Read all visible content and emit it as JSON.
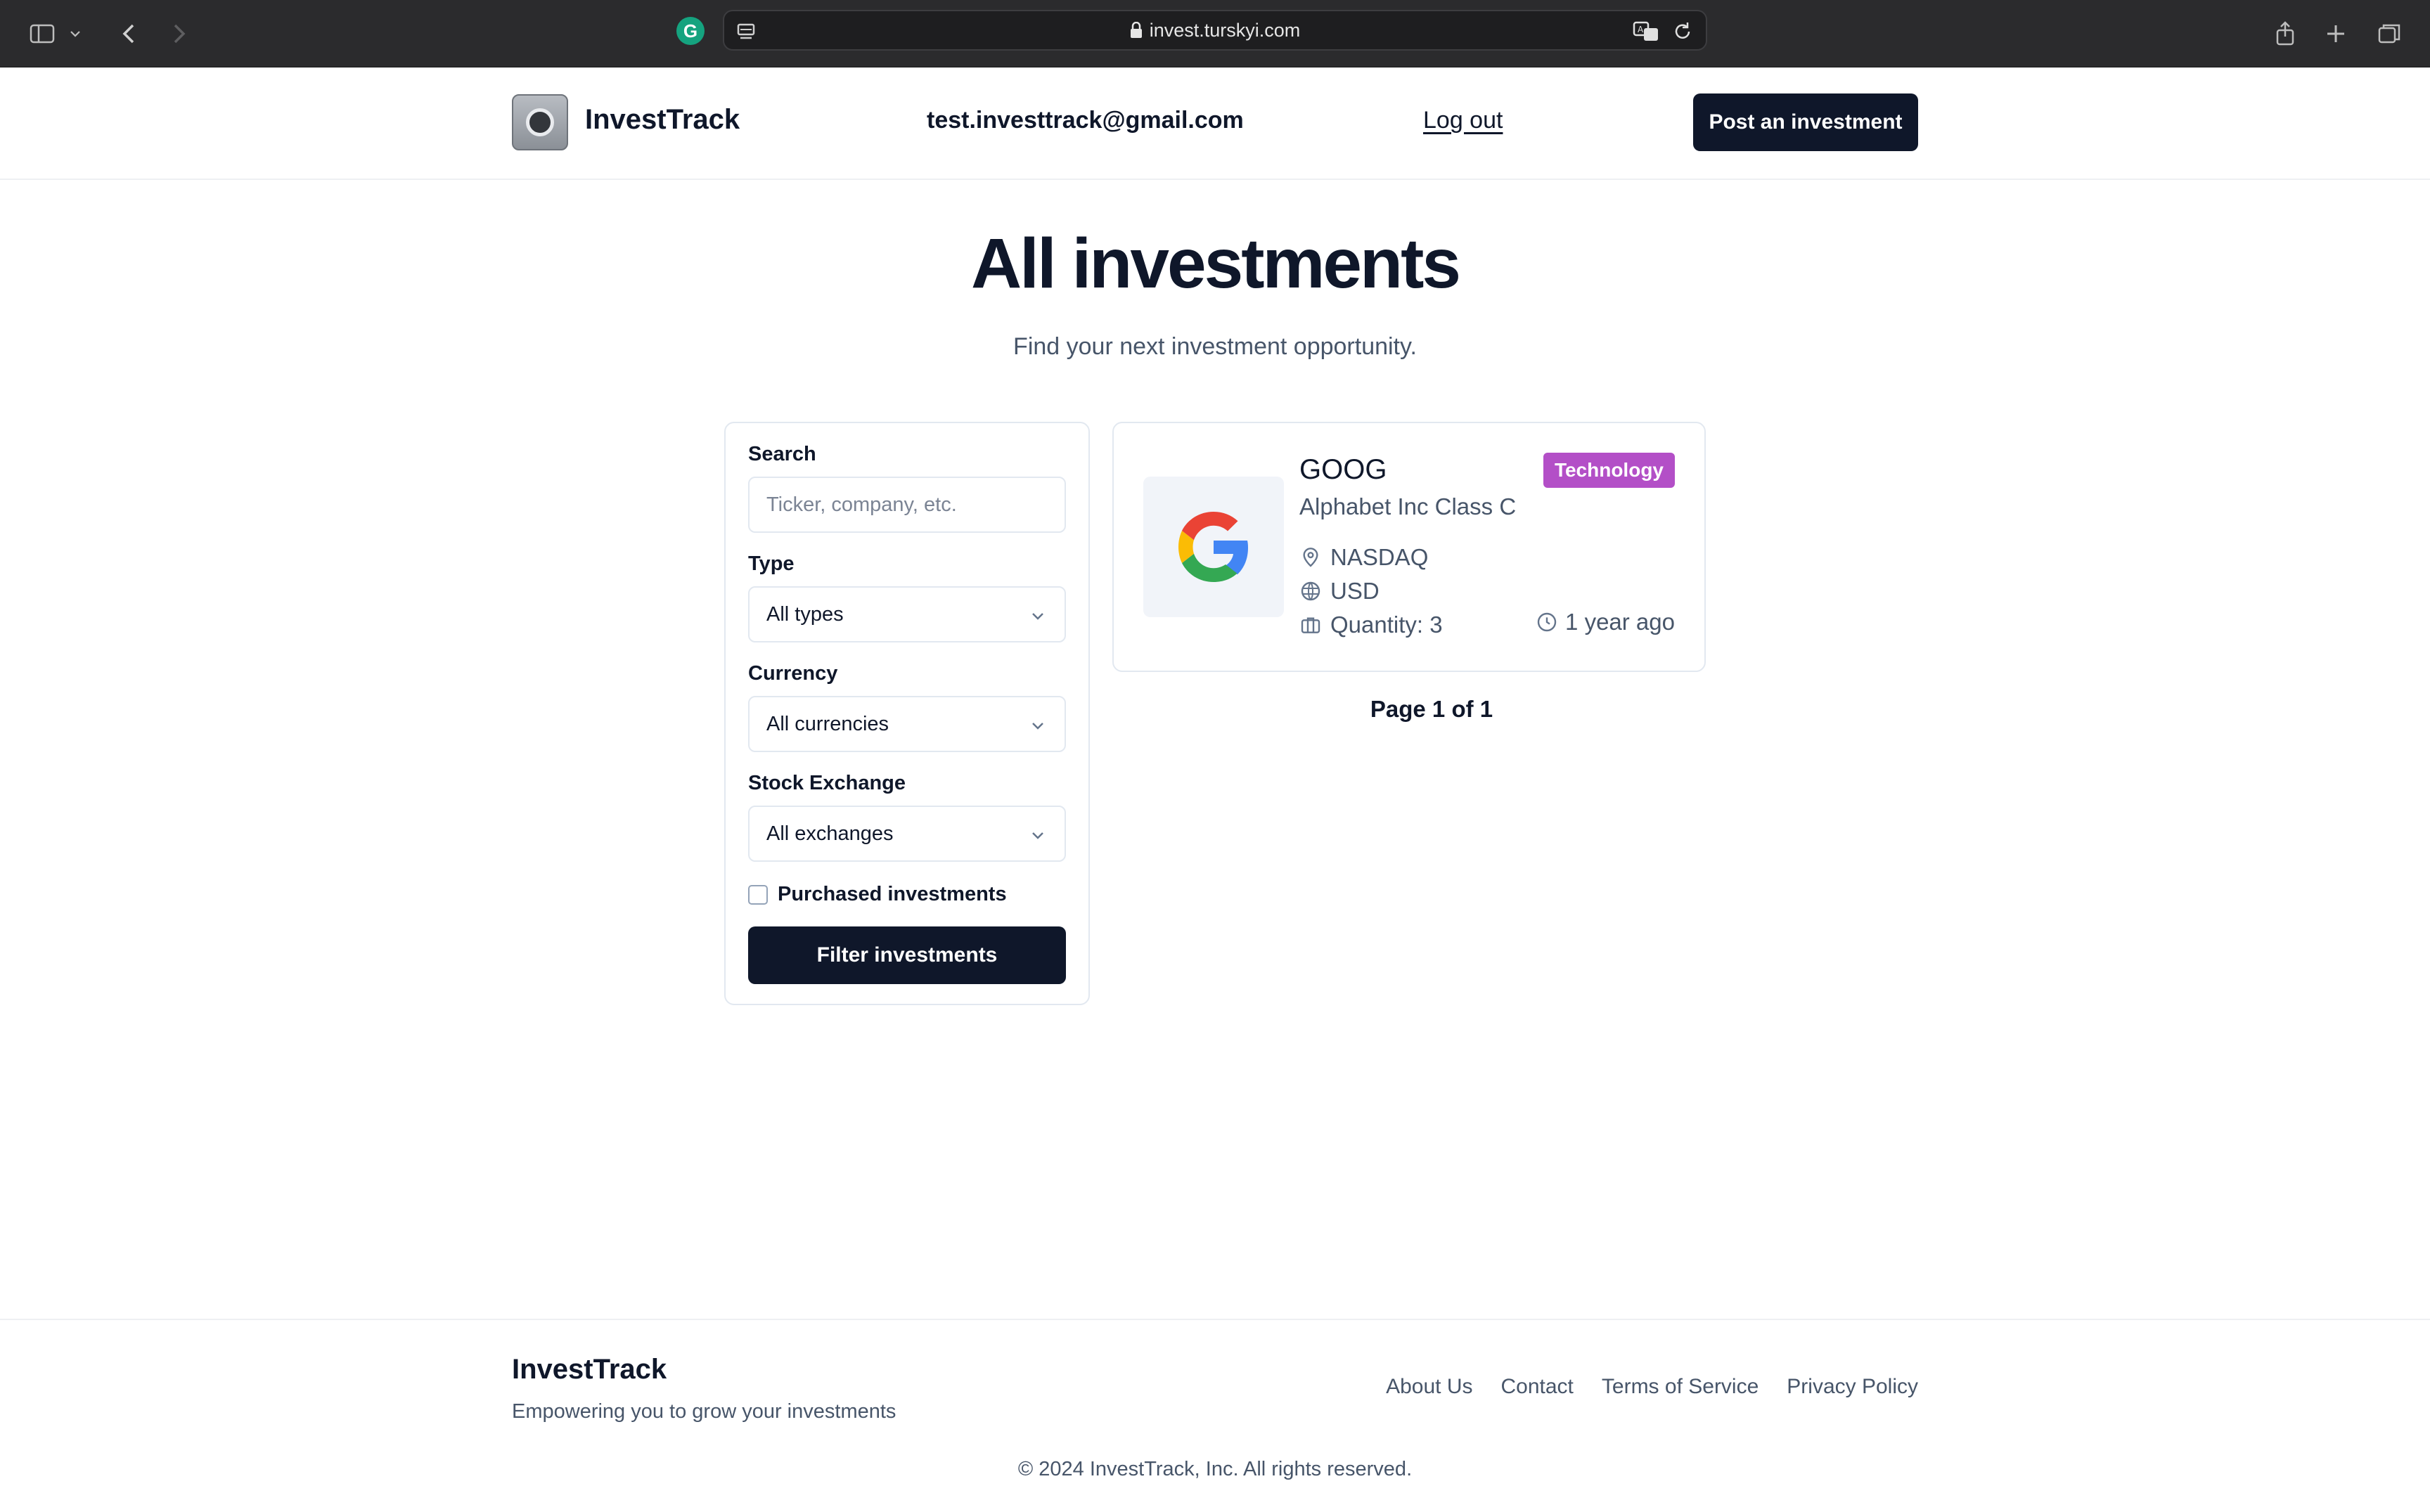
{
  "browser": {
    "url": "invest.turskyi.com",
    "grammarly_letter": "G"
  },
  "header": {
    "brand": "InvestTrack",
    "user_email": "test.investtrack@gmail.com",
    "logout_label": "Log out",
    "post_button_label": "Post an investment"
  },
  "hero": {
    "title": "All investments",
    "subtitle": "Find your next investment opportunity."
  },
  "filters": {
    "search_label": "Search",
    "search_placeholder": "Ticker, company, etc.",
    "type_label": "Type",
    "type_value": "All types",
    "currency_label": "Currency",
    "currency_value": "All currencies",
    "exchange_label": "Stock Exchange",
    "exchange_value": "All exchanges",
    "purchased_label": "Purchased investments",
    "purchased_checked": false,
    "submit_label": "Filter investments"
  },
  "investments": [
    {
      "ticker": "GOOG",
      "company": "Alphabet Inc Class C",
      "category": "Technology",
      "exchange": "NASDAQ",
      "currency": "USD",
      "quantity_text": "Quantity: 3",
      "posted": "1 year ago",
      "logo_icon": "google-logo-icon"
    }
  ],
  "pagination": {
    "text": "Page 1 of 1"
  },
  "footer": {
    "brand": "InvestTrack",
    "tagline": "Empowering you to grow your investments",
    "links": [
      "About Us",
      "Contact",
      "Terms of Service",
      "Privacy Policy"
    ],
    "copyright": "© 2024 InvestTrack, Inc. All rights reserved."
  },
  "colors": {
    "primary_dark": "#0f172a",
    "muted_text": "#475569",
    "border": "#e2e8f0",
    "technology_badge": "#b34fc7",
    "chrome_bg": "#2b2b2d"
  }
}
